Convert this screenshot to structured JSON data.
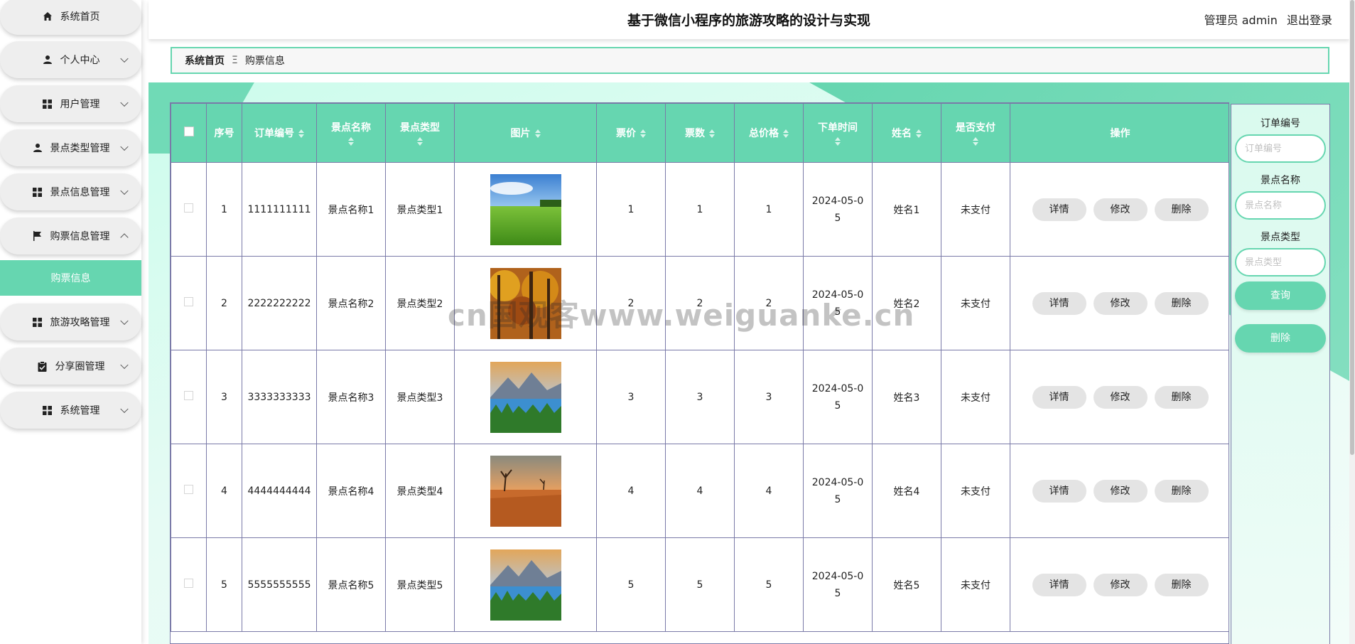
{
  "header": {
    "title": "基于微信小程序的旅游攻略的设计与实现",
    "user": "管理员 admin",
    "logout": "退出登录"
  },
  "sidebar": {
    "items": [
      {
        "label": "系统首页",
        "icon": "home-icon"
      },
      {
        "label": "个人中心",
        "icon": "user-icon"
      },
      {
        "label": "用户管理",
        "icon": "grid-icon"
      },
      {
        "label": "景点类型管理",
        "icon": "user-icon"
      },
      {
        "label": "景点信息管理",
        "icon": "grid-icon"
      },
      {
        "label": "购票信息管理",
        "icon": "flag-icon"
      },
      {
        "label": "旅游攻略管理",
        "icon": "grid-icon"
      },
      {
        "label": "分享圈管理",
        "icon": "clipboard-icon"
      },
      {
        "label": "系统管理",
        "icon": "grid-icon"
      }
    ],
    "submenu": "购票信息"
  },
  "breadcrumb": {
    "home": "系统首页",
    "sep": "Ξ",
    "current": "购票信息"
  },
  "table": {
    "headers": [
      "序号",
      "订单编号",
      "景点名称",
      "景点类型",
      "图片",
      "票价",
      "票数",
      "总价格",
      "下单时间",
      "姓名",
      "是否支付",
      "操作"
    ],
    "actions": [
      "详情",
      "修改",
      "删除"
    ],
    "rows": [
      {
        "no": "1",
        "order": "1111111111",
        "name": "景点名称1",
        "type": "景点类型1",
        "price": "1",
        "count": "1",
        "total": "1",
        "time": "2024-05-05",
        "person": "姓名1",
        "paid": "未支付",
        "image": "green-golf-field"
      },
      {
        "no": "2",
        "order": "2222222222",
        "name": "景点名称2",
        "type": "景点类型2",
        "price": "2",
        "count": "2",
        "total": "2",
        "time": "2024-05-05",
        "person": "姓名2",
        "paid": "未支付",
        "image": "autumn-forest"
      },
      {
        "no": "3",
        "order": "3333333333",
        "name": "景点名称3",
        "type": "景点类型3",
        "price": "3",
        "count": "3",
        "total": "3",
        "time": "2024-05-05",
        "person": "姓名3",
        "paid": "未支付",
        "image": "mountain-lake"
      },
      {
        "no": "4",
        "order": "4444444444",
        "name": "景点名称4",
        "type": "景点类型4",
        "price": "4",
        "count": "4",
        "total": "4",
        "time": "2024-05-05",
        "person": "姓名4",
        "paid": "未支付",
        "image": "desert-sunset"
      },
      {
        "no": "5",
        "order": "5555555555",
        "name": "景点名称5",
        "type": "景点类型5",
        "price": "5",
        "count": "5",
        "total": "5",
        "time": "2024-05-05",
        "person": "姓名5",
        "paid": "未支付",
        "image": "mountain-lake"
      }
    ]
  },
  "search": {
    "order_label": "订单编号",
    "order_placeholder": "订单编号",
    "name_label": "景点名称",
    "name_placeholder": "景点名称",
    "type_label": "景点类型",
    "type_placeholder": "景点类型",
    "query": "查询",
    "delete": "删除"
  },
  "watermark": "cn国观客www.weiguanke.cn",
  "colors": {
    "accent": "#66d6b0",
    "border": "#7a7aa8"
  }
}
